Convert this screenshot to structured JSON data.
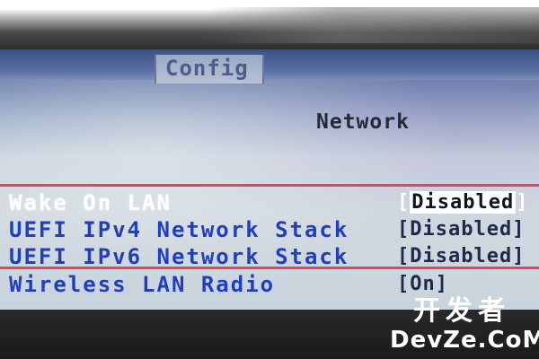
{
  "screen": {
    "tab_label": "Config",
    "section_title": "Network"
  },
  "settings": [
    {
      "label": "Wake On LAN",
      "value": "Disabled",
      "selected": true
    },
    {
      "label": "UEFI IPv4 Network Stack",
      "value": "Disabled",
      "selected": false
    },
    {
      "label": "UEFI IPv6 Network Stack",
      "value": "Disabled",
      "selected": false
    },
    {
      "label": "Wireless LAN Radio",
      "value": "On",
      "selected": false
    }
  ],
  "watermark": {
    "line1": "开发者",
    "line2": "DevZe.CoM"
  },
  "colors": {
    "label_blue": "#1f3fbf",
    "selected_text": "#ffffff",
    "highlight_rule": "#d94a5a",
    "title_bar": "#3a4f86"
  }
}
